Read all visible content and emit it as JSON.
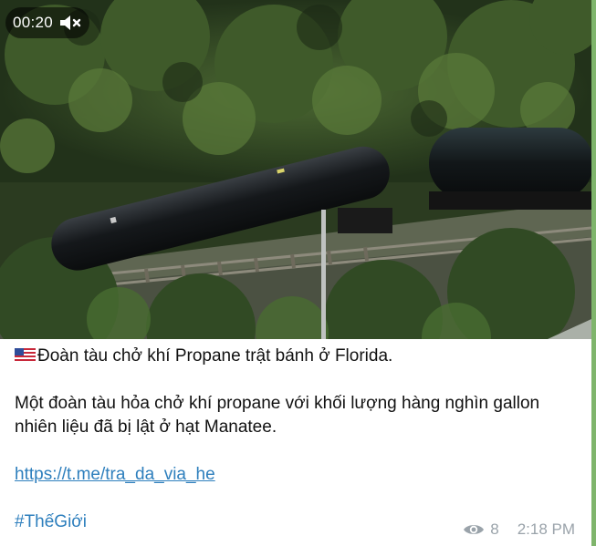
{
  "video": {
    "duration": "00:20",
    "mute_icon": "volume-muted-icon"
  },
  "caption": {
    "flag": "us-flag-icon",
    "headline": "Đoàn tàu chở khí Propane trật bánh ở Florida.",
    "body": "Một đoàn tàu hỏa chở khí propane với khối lượng hàng nghìn gallon nhiên liệu đã bị lật ở hạt Manatee.",
    "link": "https://t.me/tra_da_via_he",
    "hashtag": "#ThếGiới"
  },
  "meta": {
    "views_icon": "eye-icon",
    "views": "8",
    "time": "2:18 PM"
  },
  "colors": {
    "link": "#2e7fbd",
    "meta": "#9aa3aa",
    "accent_strip": "#7fb56c"
  }
}
